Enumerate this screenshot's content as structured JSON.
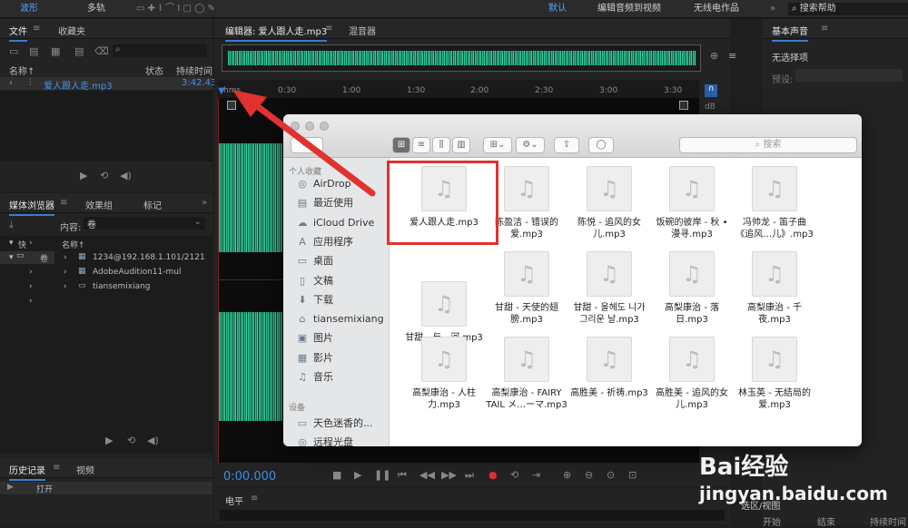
{
  "topbar": {
    "modes": [
      "波形",
      "多轨"
    ],
    "workspaces": [
      "默认",
      "编辑音频到视频",
      "无线电作品"
    ],
    "search_label": "搜索帮助"
  },
  "files_panel": {
    "tabs": [
      "文件",
      "收藏夹"
    ],
    "columns": [
      "名称↑",
      "状态",
      "持续时间"
    ],
    "file": {
      "name": "爱人跟人走.mp3",
      "duration": "3:42.43"
    }
  },
  "media_panel": {
    "tabs": [
      "媒体浏览器",
      "效果组",
      "标记"
    ],
    "content_label": "内容:",
    "content_value": "卷",
    "col_quick": "快",
    "col_name": "名称↑",
    "tree": [
      "卷"
    ],
    "items": [
      "1234@192.168.1.101/2121",
      "AdobeAudition11-mul",
      "tiansemixiang"
    ]
  },
  "history_panel": {
    "tabs": [
      "历史记录",
      "视频"
    ],
    "item": "打开"
  },
  "editor": {
    "tabs": [
      "编辑器: 爱人跟人走.mp3",
      "混音器"
    ],
    "timeline": [
      "hms",
      "0:30",
      "1:00",
      "1:30",
      "2:00",
      "2:30",
      "3:00",
      "3:30"
    ],
    "db_label": "dB",
    "time": "0:00.000"
  },
  "levels": {
    "title": "电平"
  },
  "right_panel": {
    "title": "基本声音",
    "no_selection": "无选择项",
    "preset_label": "预设:",
    "sel_title": "选区/视图",
    "sel_cols": [
      "开始",
      "结束",
      "持续时间"
    ]
  },
  "finder": {
    "search_placeholder": "搜索",
    "favorites_header": "个人收藏",
    "favorites": [
      {
        "icon": "airdrop-icon",
        "label": "AirDrop"
      },
      {
        "icon": "recent-icon",
        "label": "最近使用"
      },
      {
        "icon": "icloud-icon",
        "label": "iCloud Drive"
      },
      {
        "icon": "apps-icon",
        "label": "应用程序"
      },
      {
        "icon": "desktop-icon",
        "label": "桌面"
      },
      {
        "icon": "documents-icon",
        "label": "文稿"
      },
      {
        "icon": "downloads-icon",
        "label": "下载"
      },
      {
        "icon": "home-icon",
        "label": "tiansemixiang"
      },
      {
        "icon": "pictures-icon",
        "label": "图片"
      },
      {
        "icon": "movies-icon",
        "label": "影片"
      },
      {
        "icon": "music-icon",
        "label": "音乐"
      }
    ],
    "devices_header": "设备",
    "devices": [
      {
        "icon": "disk-icon",
        "label": "天色迷香的..."
      },
      {
        "icon": "optical-icon",
        "label": "远程光盘"
      }
    ],
    "files": [
      "爱人跟人走.mp3",
      "陈盈洁 - 错误的\n爱.mp3",
      "陈悦 - 追风的女\n儿.mp3",
      "饭碗的彼岸 - 秋 •\n漫寻.mp3",
      "冯帅龙 - 笛子曲\n《追风…儿》.mp3",
      "甘甜 - 与…河.mp3",
      "甘甜 - 天使的翅\n膀.mp3",
      "甘甜 - 울헤도 니가\n그리운 날.mp3",
      "高梨康治 - 落\n日.mp3",
      "高梨康治 - 千\n夜.mp3",
      "高梨康治 - 人柱\n力.mp3",
      "高梨康治 - FAIRY\nTAIL メ…ーマ.mp3",
      "高胜美 - 祈祷.mp3",
      "高胜美 - 追风的女\n儿.mp3",
      "林玉英 - 无结局的\n爱.mp3"
    ]
  },
  "watermark": {
    "brand": "Bai经验",
    "url": "jingyan.baidu.com"
  }
}
